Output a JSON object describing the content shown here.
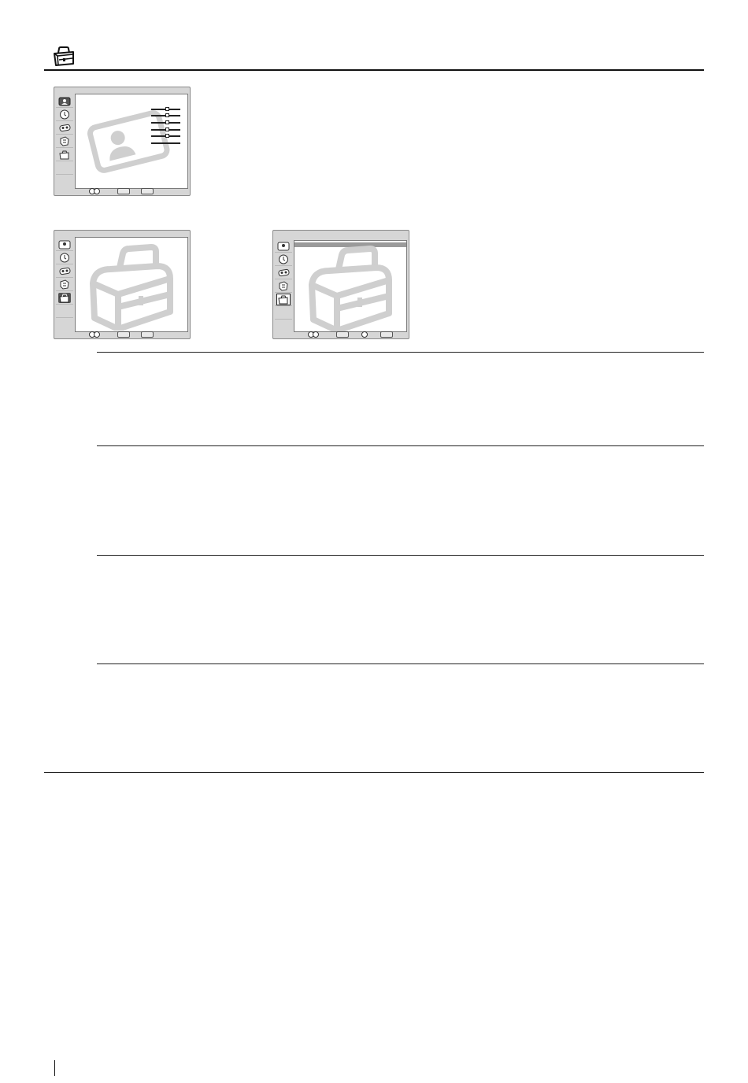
{
  "page": {
    "header_icon": "toolbox-icon"
  },
  "screens": [
    {
      "id": "picture-menu",
      "watermark_icon": "portrait-card-icon",
      "active_item": 0,
      "slider_count": 6
    },
    {
      "id": "setup-menu",
      "watermark_icon": "toolbox-icon",
      "active_item": 4
    },
    {
      "id": "setup-submenu",
      "watermark_icon": "toolbox-icon",
      "active_item": 4,
      "has_highlight_bar": true
    }
  ],
  "sidebar_icons": [
    "picture-icon",
    "clock-icon",
    "sound-icon",
    "input-icon",
    "toolbox-icon"
  ],
  "colors": {
    "osd_frame": "#d6d6d6",
    "watermark": "#cfcfcf",
    "rule": "#222222"
  }
}
